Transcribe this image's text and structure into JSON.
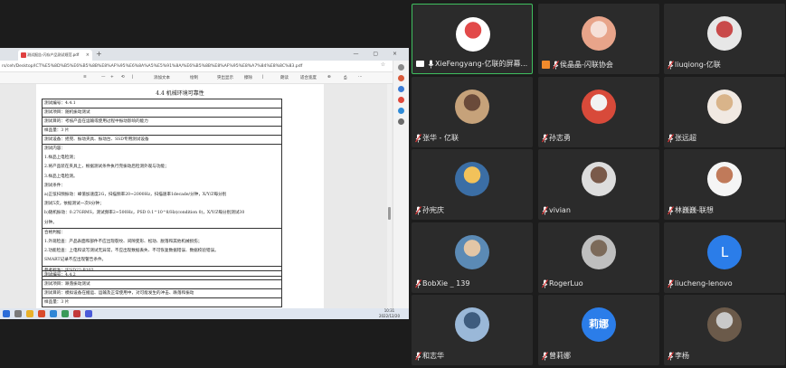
{
  "browser": {
    "tab_title": "测试报告-闪存产品测试规范.pdf",
    "tab_close": "×",
    "tab_new": "+",
    "window_controls": "— ▢ ×",
    "address": "rs/ceh/Desktop/ICT%E5%8D%B5%E6%B5%8B%E8%AF%95%E6%8A%A5%E5%91%8A/%E6%B5%8B%E8%AF%95%E8%A7%84%E8%8C%83.pdf",
    "pdf_tools": [
      "≡",
      "—",
      "+",
      "⟲",
      "|",
      "添加文本",
      "绘制",
      "突出显示",
      "擦除",
      "|",
      "朗读",
      "适合宽度",
      "⊕",
      "⎙",
      "⋯"
    ]
  },
  "document": {
    "heading": "4.4 机械环境可靠性",
    "table1": [
      "测试编号：4.4.1",
      "测试项目：随机振动测试",
      "测试目的：考核产品在运输或使用过程中振动影响的能力",
      "样品量：3 片",
      "测试设备：摇晃、振动夹具、振动台、SSD专用测试设备"
    ],
    "table1_body": [
      "测试内容：",
      "1.样品上电检测；",
      "2.将产品装在夹具上，根据测试条件执行完振动后检测外观与功能；",
      "3.样品上电检测。",
      "测试条件：",
      "    a)正弦扫频振动：峰值加速度2G，扫描频率20~2000Hz，扫描速率1decade/分钟，X/Y/Z每分别",
      "测试5次，依据测试一次8分钟；",
      "    b)随机振动：0.27GRMS，测试频率2~500Hz，PSD 0.1^10^8/Hz(condition 0)，X/Y/Z每分别测试30",
      "分钟。",
      "合格判据：",
      "1.外观检查：产品表面和部件不应出现裂纹、间隙变形、松动、脱落和其他机械损伤；",
      "2.功能检查：上电和读写测试无异常，不应出现数据丢失、不可恢复数据错误、数据校验错误。",
      "  SMART记录不应出现警告条件。",
      "参考标准：JESD22-B103"
    ],
    "table2": [
      "测试编号：4.4.2",
      "测试项目：跌落振动测试",
      "测试目的：模拟设备在搬运、运输及正常使用中，对可能发生的冲击、跌落和振动",
      "样品量：3 片"
    ]
  },
  "taskbar": {
    "time": "10:31",
    "date": "2022/12/20"
  },
  "participants": [
    {
      "name": "XieFengyang-亿联的屏幕...",
      "mic": "unmuted",
      "sharing": true,
      "active": true,
      "avatar": "photo"
    },
    {
      "name": "侯晶晶-闪联协会",
      "mic": "muted",
      "host": true,
      "avatar": "photo"
    },
    {
      "name": "liuqiong-亿联",
      "mic": "muted",
      "avatar": "photo"
    },
    {
      "name": "张华 - 亿联",
      "mic": "muted",
      "avatar": "photo"
    },
    {
      "name": "孙志勇",
      "mic": "muted",
      "avatar": "photo"
    },
    {
      "name": "张远超",
      "mic": "muted",
      "avatar": "photo"
    },
    {
      "name": "孙宪庆",
      "mic": "muted",
      "avatar": "photo"
    },
    {
      "name": "vivian",
      "mic": "muted",
      "avatar": "photo"
    },
    {
      "name": "林巍巍-联想",
      "mic": "muted",
      "avatar": "photo"
    },
    {
      "name": "BobXie _ 139",
      "mic": "muted",
      "avatar": "photo"
    },
    {
      "name": "RogerLuo",
      "mic": "muted",
      "avatar": "photo"
    },
    {
      "name": "liucheng-lenovo",
      "mic": "muted",
      "avatar": "letter",
      "letter": "L"
    },
    {
      "name": "和志华",
      "mic": "muted",
      "avatar": "photo"
    },
    {
      "name": "曾莉娜",
      "mic": "muted",
      "avatar": "letter",
      "letter": "莉娜"
    },
    {
      "name": "李杨",
      "mic": "muted",
      "avatar": "photo"
    }
  ],
  "colors": {
    "background": "#1c1c1c",
    "tile": "#2b2b2b",
    "active_border": "#3fbf5f",
    "muted_red": "#e03a3a",
    "letter_avatar": "#2b7de9"
  }
}
